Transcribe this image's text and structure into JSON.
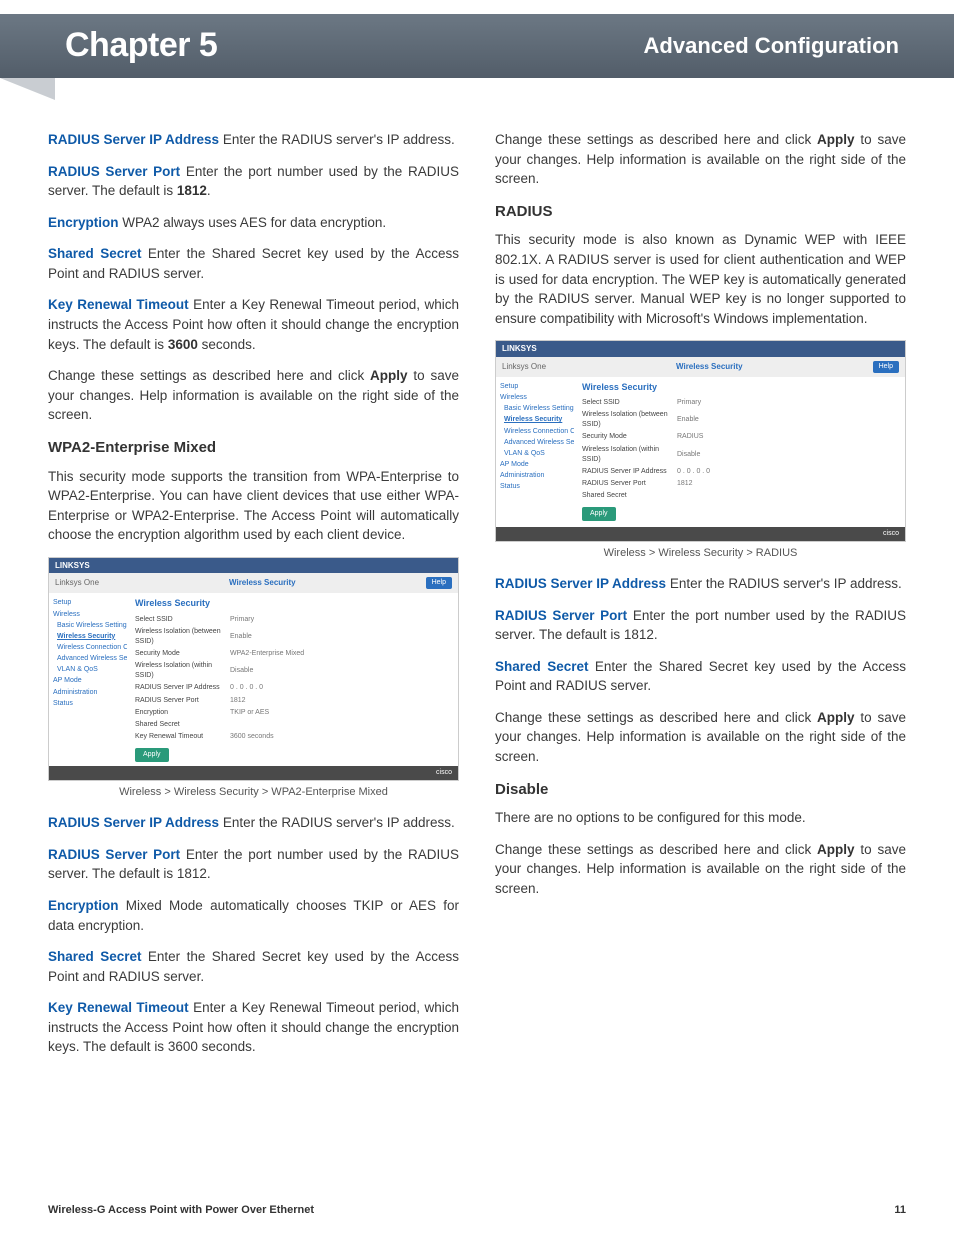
{
  "header": {
    "chapter": "Chapter 5",
    "section": "Advanced Configuration"
  },
  "col1": {
    "p1_term": "RADIUS Server IP Address",
    "p1_rest": "  Enter the RADIUS server's IP address.",
    "p2_term": "RADIUS Server Port",
    "p2_rest_a": "  Enter the port number used by the RADIUS server. The default is ",
    "p2_bold": "1812",
    "p2_rest_b": ".",
    "p3_term": "Encryption",
    "p3_rest": "  WPA2 always uses AES for data encryption.",
    "p4_term": "Shared Secret",
    "p4_rest": "  Enter the Shared Secret key used by the Access Point and RADIUS server.",
    "p5_term": "Key Renewal Timeout",
    "p5_rest_a": " Enter a Key Renewal Timeout period, which instructs the Access Point how often it should change the encryption keys. The default is ",
    "p5_bold": "3600",
    "p5_rest_b": " seconds.",
    "p6_a": "Change these settings as described here and click ",
    "p6_bold": "Apply",
    "p6_b": " to save your changes. Help information is available on the right side of the screen.",
    "h_wpa2mixed": "WPA2-Enterprise Mixed",
    "p7": "This security mode supports the transition from WPA-Enterprise to WPA2-Enterprise. You can have client devices that use either WPA-Enterprise or WPA2-Enterprise. The Access Point will automatically choose the encryption algorithm used by each client device.",
    "caption1": "Wireless > Wireless Security > WPA2-Enterprise Mixed",
    "p8_term": "RADIUS Server IP Address",
    "p8_rest": "  Enter the RADIUS server's IP address.",
    "p9_term": "RADIUS Server Port",
    "p9_rest": "  Enter the port number used by the RADIUS server. The default is 1812.",
    "p10_term": "Encryption",
    "p10_rest": "  Mixed Mode automatically chooses TKIP or AES for data encryption.",
    "p11_term": "Shared Secret",
    "p11_rest": "  Enter the Shared Secret key used by the Access Point and RADIUS server.",
    "p12_term": "Key Renewal Timeout",
    "p12_rest": " Enter a Key Renewal Timeout period, which instructs the Access Point how often it should change the encryption keys. The default is 3600 seconds."
  },
  "col2": {
    "p1_a": "Change these settings as described here and click ",
    "p1_bold": "Apply",
    "p1_b": " to save your changes. Help information is available on the right side of the screen.",
    "h_radius": "RADIUS",
    "p2": "This security mode is also known as Dynamic WEP with IEEE 802.1X. A RADIUS server is used for client authentication and WEP is used for data encryption. The WEP key is automatically generated by the RADIUS server. Manual WEP key is no longer supported to ensure compatibility with Microsoft's Windows implementation.",
    "caption2": "Wireless > Wireless Security > RADIUS",
    "p3_term": "RADIUS Server IP Address",
    "p3_rest": "  Enter the RADIUS server's IP address.",
    "p4_term": "RADIUS Server Port",
    "p4_rest": "  Enter the port number used by the RADIUS server. The default is 1812.",
    "p5_term": "Shared Secret",
    "p5_rest": "  Enter the Shared Secret key used by the Access Point and RADIUS server.",
    "p6_a": "Change these settings as described here and click ",
    "p6_bold": "Apply",
    "p6_b": " to save your changes. Help information is available on the right side of the screen.",
    "h_disable": "Disable",
    "p7": "There are no options to be configured for this mode.",
    "p8_a": "Change these settings as described here and click ",
    "p8_bold": "Apply",
    "p8_b": " to save your changes. Help information is available on the right side of the screen."
  },
  "shot": {
    "brand": "LINKSYS",
    "crumb_left": "Linksys One",
    "crumb_title": "Wireless Security",
    "help": "Help",
    "nav": [
      "Setup",
      "Wireless",
      "Basic Wireless Settings",
      "Wireless Security",
      "Wireless Connection Control",
      "Advanced Wireless Settings",
      "VLAN & QoS",
      "AP Mode",
      "Administration",
      "Status"
    ],
    "rows_mixed": [
      {
        "lab": "Select SSID",
        "ctl": "Primary"
      },
      {
        "lab": "Wireless Isolation (between SSID)",
        "ctl": "Enable"
      },
      {
        "lab": "Security Mode",
        "ctl": "WPA2-Enterprise Mixed"
      },
      {
        "lab": "Wireless Isolation (within SSID)",
        "ctl": "Disable"
      },
      {
        "lab": "RADIUS Server IP Address",
        "ctl": "0 . 0 . 0 . 0"
      },
      {
        "lab": "RADIUS Server Port",
        "ctl": "1812"
      },
      {
        "lab": "Encryption",
        "ctl": "TKIP or AES"
      },
      {
        "lab": "Shared Secret",
        "ctl": ""
      },
      {
        "lab": "Key Renewal Timeout",
        "ctl": "3600  seconds"
      }
    ],
    "rows_radius": [
      {
        "lab": "Select SSID",
        "ctl": "Primary"
      },
      {
        "lab": "Wireless Isolation (between SSID)",
        "ctl": "Enable"
      },
      {
        "lab": "Security Mode",
        "ctl": "RADIUS"
      },
      {
        "lab": "Wireless Isolation (within SSID)",
        "ctl": "Disable"
      },
      {
        "lab": "RADIUS Server IP Address",
        "ctl": "0 . 0 . 0 . 0"
      },
      {
        "lab": "RADIUS Server Port",
        "ctl": "1812"
      },
      {
        "lab": "Shared Secret",
        "ctl": ""
      }
    ],
    "apply": "Apply",
    "foot": "cisco"
  },
  "footer": {
    "product": "Wireless-G Access Point with  Power Over Ethernet",
    "page": "11"
  }
}
